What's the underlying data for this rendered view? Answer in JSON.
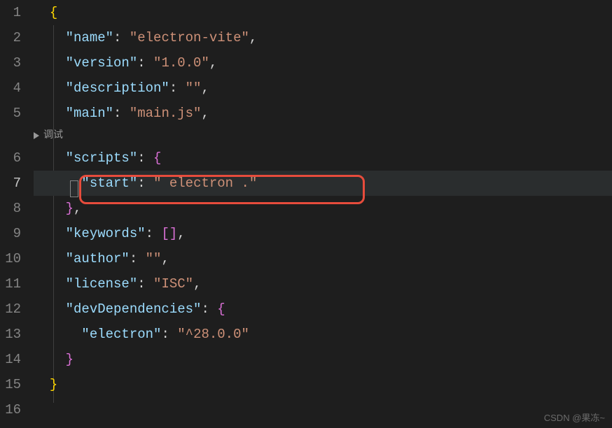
{
  "codelens": {
    "label": "调试"
  },
  "gutter": {
    "activeLine": 7
  },
  "lines": {
    "l1": {
      "brace": "{"
    },
    "l2": {
      "key": "\"name\"",
      "colon": ": ",
      "val": "\"electron-vite\"",
      "comma": ","
    },
    "l3": {
      "key": "\"version\"",
      "colon": ": ",
      "val": "\"1.0.0\"",
      "comma": ","
    },
    "l4": {
      "key": "\"description\"",
      "colon": ": ",
      "val": "\"\"",
      "comma": ","
    },
    "l5": {
      "key": "\"main\"",
      "colon": ": ",
      "val": "\"main.js\"",
      "comma": ","
    },
    "l6": {
      "key": "\"scripts\"",
      "colon": ": ",
      "brace": "{"
    },
    "l7": {
      "key": "\"start\"",
      "colon": ": ",
      "val": "\" electron .\""
    },
    "l8": {
      "brace": "}",
      "comma": ","
    },
    "l9": {
      "key": "\"keywords\"",
      "colon": ": ",
      "open": "[",
      "close": "]",
      "comma": ","
    },
    "l10": {
      "key": "\"author\"",
      "colon": ": ",
      "val": "\"\"",
      "comma": ","
    },
    "l11": {
      "key": "\"license\"",
      "colon": ": ",
      "val": "\"ISC\"",
      "comma": ","
    },
    "l12": {
      "key": "\"devDependencies\"",
      "colon": ": ",
      "brace": "{"
    },
    "l13": {
      "key": "\"electron\"",
      "colon": ": ",
      "val": "\"^28.0.0\""
    },
    "l14": {
      "brace": "}"
    },
    "l15": {
      "brace": "}"
    }
  },
  "watermark": "CSDN @果冻~"
}
